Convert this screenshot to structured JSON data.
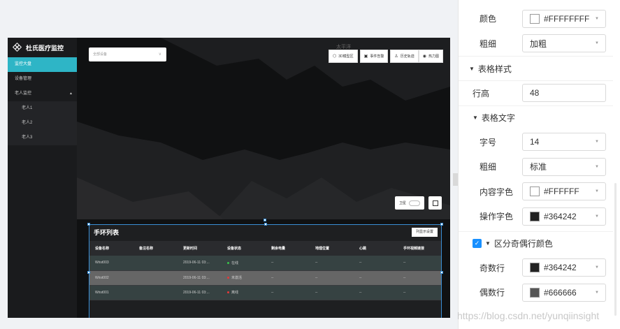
{
  "app": {
    "title": "杜氏医疗监控",
    "nav": [
      {
        "label": "监控大盘",
        "active": true
      },
      {
        "label": "设备管理",
        "active": false
      },
      {
        "label": "老人监控",
        "active": false
      }
    ],
    "sub_nav": [
      "老人1",
      "老人2",
      "老人3"
    ]
  },
  "map": {
    "device_select_placeholder": "全部设备",
    "region_label": "太平洋",
    "tools": {
      "model_3d": "3D模型区",
      "event_alert": "事件告警",
      "history_track": "历史轨迹",
      "heatmap": "热力图"
    },
    "satellite_label": "卫星"
  },
  "panel": {
    "title": "手环列表",
    "column_settings_label": "列显示设置",
    "columns": [
      "设备名称",
      "备注名称",
      "更新时间",
      "设备状态",
      "剩余电量",
      "地理位置",
      "心跳",
      "手环视频链接"
    ],
    "rows": [
      {
        "name": "Wrist003",
        "remark": "",
        "time": "2019-06-11 03:...",
        "status": "在线",
        "status_color": "#39c24a",
        "battery": "--",
        "location": "--",
        "heartbeat": "--",
        "video": "--"
      },
      {
        "name": "Wrist002",
        "remark": "",
        "time": "2019-06-11 03:...",
        "status": "未激活",
        "status_color": "#e5393a",
        "battery": "--",
        "location": "--",
        "heartbeat": "--",
        "video": "--"
      },
      {
        "name": "Wrist001",
        "remark": "",
        "time": "2019-06-11 03:...",
        "status": "离线",
        "status_color": "#e5393a",
        "battery": "--",
        "location": "--",
        "heartbeat": "--",
        "video": "--"
      }
    ]
  },
  "settings": {
    "color_label": "颜色",
    "color_value": "#FFFFFFFF",
    "weight_label": "粗细",
    "weight_value": "加粗",
    "table_style_title": "表格样式",
    "row_height_label": "行高",
    "row_height_value": "48",
    "table_text_title": "表格文字",
    "font_size_label": "字号",
    "font_size_value": "14",
    "text_weight_label": "粗细",
    "text_weight_value": "标准",
    "content_color_label": "内容字色",
    "content_color_value": "#FFFFFF",
    "action_color_label": "操作字色",
    "action_color_value": "#364242",
    "zebra_title": "区分奇偶行颜色",
    "odd_label": "奇数行",
    "odd_value": "#364242",
    "even_label": "偶数行",
    "even_value": "#666666"
  },
  "watermark": "https://blog.csdn.net/yunqiinsight"
}
